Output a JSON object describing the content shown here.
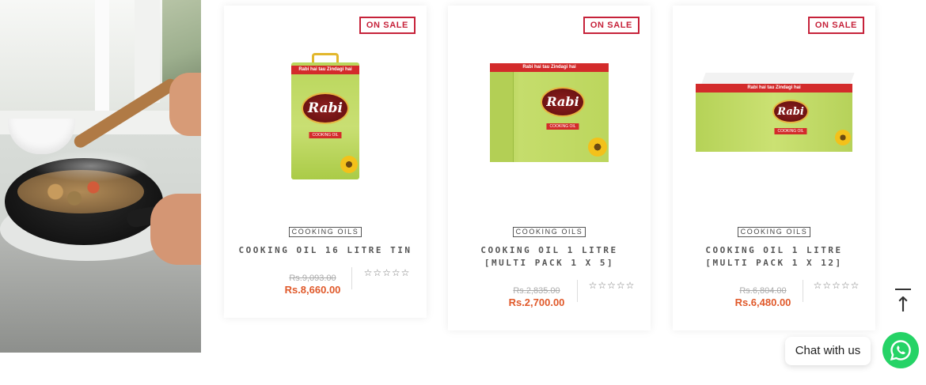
{
  "products": [
    {
      "badge": "ON SALE",
      "category": "COOKING OILS",
      "title_line1": "COOKING OIL 16 LITRE TIN",
      "title_line2": "",
      "old_price": "Rs.9,093.00",
      "new_price": "Rs.8,660.00",
      "rating": 0,
      "pack": {
        "strip": "Rabi hai tau Zindagi hai",
        "brand": "Rabi",
        "label": "COOKING OIL"
      }
    },
    {
      "badge": "ON SALE",
      "category": "COOKING OILS",
      "title_line1": "COOKING OIL 1 LITRE",
      "title_line2": "[MULTI PACK 1 X 5]",
      "old_price": "Rs.2,835.00",
      "new_price": "Rs.2,700.00",
      "rating": 0,
      "pack": {
        "strip": "Rabi hai tau Zindagi hai",
        "brand": "Rabi",
        "label": "COOKING OIL"
      }
    },
    {
      "badge": "ON SALE",
      "category": "COOKING OILS",
      "title_line1": "COOKING OIL 1 LITRE",
      "title_line2": "[MULTI PACK 1 X 12]",
      "old_price": "Rs.6,804.00",
      "new_price": "Rs.6,480.00",
      "rating": 0,
      "pack": {
        "strip": "Rabi hai tau Zindagi hai",
        "brand": "Rabi",
        "label": "COOKING OIL"
      }
    }
  ],
  "star_glyphs": "☆☆☆☆☆",
  "back_to_top": {
    "arrow": "↑"
  },
  "chat": {
    "label": "Chat with us"
  },
  "icons": {
    "whatsapp": "whatsapp-icon",
    "back_to_top": "arrow-up-icon",
    "rating": "star-outline-icon"
  },
  "colors": {
    "badge": "#c6223a",
    "sale_price": "#e0592a",
    "whatsapp": "#25d366"
  }
}
